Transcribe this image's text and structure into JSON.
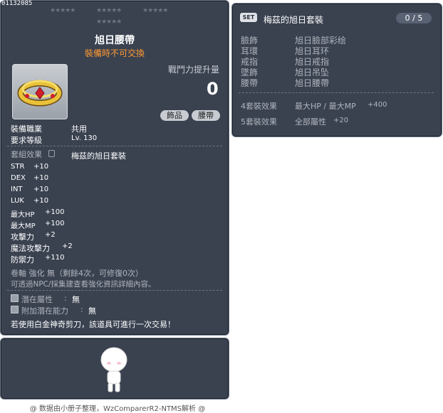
{
  "item": {
    "id": "01132085",
    "stars": [
      "★★★★★",
      "★★★★★",
      "★★★★★",
      "★★★★★"
    ],
    "name": "旭日腰帶",
    "trade_note": "裝備時不可交換",
    "icon": "belt-ring-icon",
    "combat_power_label": "戰鬥力提升量",
    "combat_power_value": "0",
    "tags": [
      "飾品",
      "腰帶"
    ],
    "job_label": "裝備職業",
    "job_value": "共用",
    "level_label": "要求等級",
    "level_value": "Lv. 130",
    "set_label": "套組效果",
    "set_value": "梅茲的旭日套裝",
    "stats": [
      {
        "name": "STR",
        "value": "+10"
      },
      {
        "name": "DEX",
        "value": "+10"
      },
      {
        "name": "INT",
        "value": "+10"
      },
      {
        "name": "LUK",
        "value": "+10"
      },
      {
        "name": "最大HP",
        "value": "+100"
      },
      {
        "name": "最大MP",
        "value": "+100"
      },
      {
        "name": "攻擊力",
        "value": "+2"
      },
      {
        "name": "魔法攻擊力",
        "value": "+2"
      },
      {
        "name": "防禦力",
        "value": "+110"
      }
    ],
    "scroll_line": "卷軸 強化 無（剩餘4次，可修復0次）",
    "npc_line": "可透過NPC/採集建查看強化資訊詳細內容。",
    "potential_label": "潛在屬性",
    "potential_value": "無",
    "bonus_potential_label": "附加潛在能力",
    "bonus_potential_value": "無",
    "scissors_note": "若使用白金神奇剪刀，該道具可進行一次交易！"
  },
  "set": {
    "badge": "SET",
    "name": "梅茲的旭日套裝",
    "count": "0 / 5",
    "pieces": [
      {
        "slot": "臉飾",
        "item": "旭日臉部彩绘"
      },
      {
        "slot": "耳環",
        "item": "旭日耳环"
      },
      {
        "slot": "戒指",
        "item": "旭日戒指"
      },
      {
        "slot": "墜飾",
        "item": "旭日吊坠"
      },
      {
        "slot": "腰帶",
        "item": "旭日腰帶"
      }
    ],
    "effects": [
      {
        "label": "4套裝效果",
        "stat": "最大HP / 最大MP",
        "value": "+400"
      },
      {
        "label": "5套裝效果",
        "stat": "全部屬性",
        "value": "+20"
      }
    ]
  },
  "footer": "@ 数据由小册子整理，WzComparerR2-NTMS解析 @",
  "colors": {
    "panel": "#3a4250",
    "accent_orange": "#ff9933"
  }
}
